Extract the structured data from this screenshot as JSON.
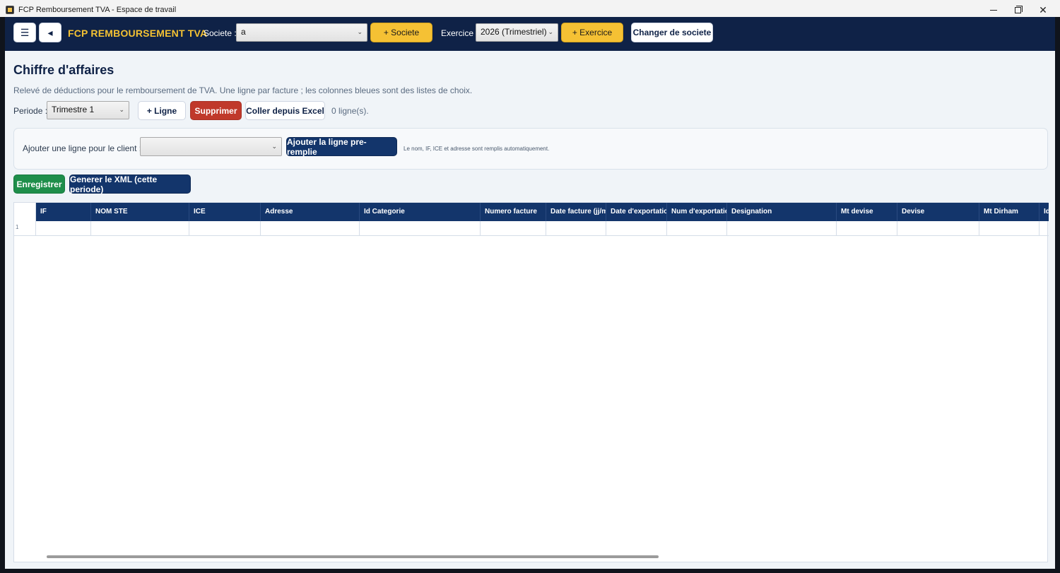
{
  "window": {
    "title": "FCP Remboursement TVA - Espace de travail",
    "min_glyph": "–",
    "close_glyph": "✕"
  },
  "header": {
    "menu_glyph": "☰",
    "back_glyph": "◂",
    "brand": "FCP REMBOURSEMENT TVA",
    "societe_label": "Societe :",
    "societe_value": "a",
    "add_societe": "+ Societe",
    "exercice_label": "Exercice :",
    "exercice_value": "2026 (Trimestriel)",
    "add_exercice": "+ Exercice",
    "change_societe": "Changer de societe"
  },
  "page": {
    "title": "Chiffre d'affaires",
    "subtitle": "Relevé de déductions pour le remboursement de TVA. Une ligne par facture ; les colonnes bleues sont des listes de choix.",
    "periode_label": "Periode :",
    "periode_value": "Trimestre 1",
    "add_line": "+ Ligne",
    "delete": "Supprimer",
    "paste_excel": "Coller depuis Excel",
    "line_count": "0 ligne(s)."
  },
  "client_panel": {
    "label": "Ajouter une ligne pour le client :",
    "client_value": "",
    "add_prefilled": "Ajouter la ligne pre-remplie",
    "hint": "Le nom, IF, ICE et adresse sont remplis automatiquement."
  },
  "actions": {
    "save": "Enregistrer",
    "generate_xml": "Generer le XML (cette periode)"
  },
  "grid": {
    "columns": [
      "IF",
      "NOM STE",
      "ICE",
      "Adresse",
      "Id Categorie",
      "Numero facture",
      "Date facture (jj/mm/aaaa)",
      "Date d'exportation",
      "Num d'exportation",
      "Designation",
      "Mt devise",
      "Devise",
      "Mt Dirham",
      "Id"
    ],
    "rows": [
      {
        "num": "1"
      }
    ]
  },
  "colors": {
    "navy": "#0f2247",
    "accent_yellow": "#f5c134",
    "danger": "#c0392b",
    "success": "#1e8e4a",
    "table_header": "#13356b"
  }
}
